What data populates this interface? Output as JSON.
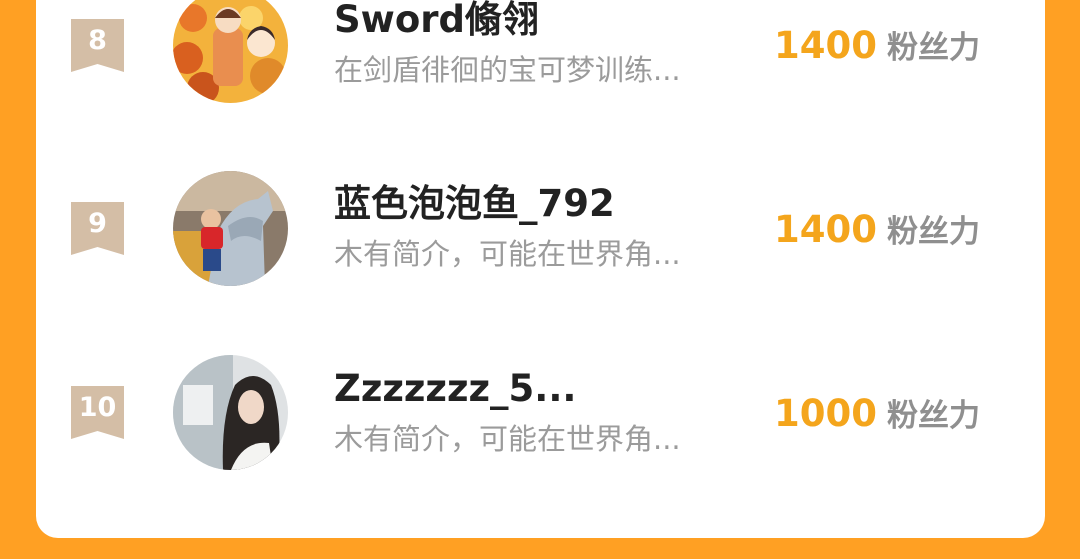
{
  "colors": {
    "frame_orange": "#ffa023",
    "score_orange": "#f4a51c",
    "rank_badge": "#d4bea6",
    "name": "#222222",
    "bio": "#9b9b9b",
    "unit": "#8f8f8f"
  },
  "rows": [
    {
      "rank": "8",
      "name": "Sword翛翎",
      "bio": "在剑盾徘徊的宝可梦训练...",
      "score": "1400",
      "unit": "粉丝力",
      "avatar_icon": "avatar-illustrated-girl-orange-flowers"
    },
    {
      "rank": "9",
      "name": "蓝色泡泡鱼_792",
      "bio": "木有简介，可能在世界角...",
      "score": "1400",
      "unit": "粉丝力",
      "avatar_icon": "avatar-child-on-horse-statue"
    },
    {
      "rank": "10",
      "name": "Zzzzzzz_5...",
      "bio": "木有简介，可能在世界角...",
      "score": "1000",
      "unit": "粉丝力",
      "avatar_icon": "avatar-girl-long-hair-photo"
    }
  ]
}
